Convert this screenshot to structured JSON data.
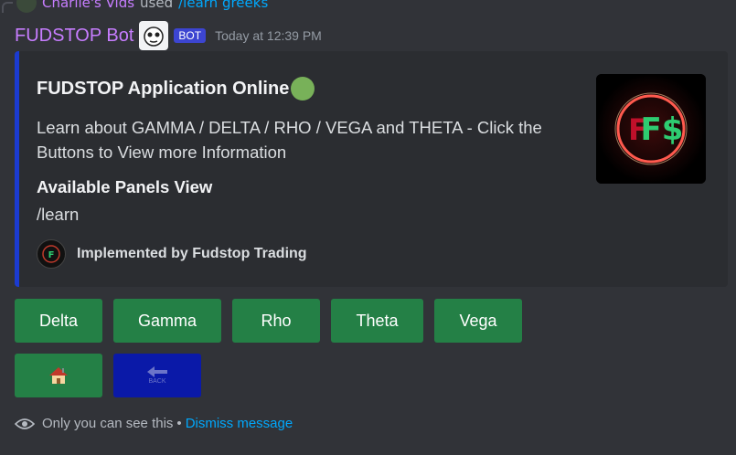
{
  "reply": {
    "user": "Charlie's Vids",
    "used_text": "used",
    "command": "/learn greeks"
  },
  "message": {
    "username": "FUDSTOP Bot",
    "badge": "BOT",
    "timestamp": "Today at 12:39 PM"
  },
  "embed": {
    "accent_color": "#1b3bd1",
    "title": "FUDSTOP Application Online",
    "description": "Learn about GAMMA / DELTA / RHO / VEGA and THETA - Click the Buttons to View more Information",
    "field_name": "Available Panels View",
    "field_value": "/learn",
    "footer": "Implemented by Fudstop Trading",
    "thumbnail_text": "F$"
  },
  "buttons": {
    "row1": [
      "Delta",
      "Gamma",
      "Rho",
      "Theta",
      "Vega"
    ],
    "home_icon": "house-icon",
    "back_label": "BACK"
  },
  "ephemeral": {
    "notice": "Only you can see this",
    "separator": "•",
    "dismiss": "Dismiss message"
  }
}
